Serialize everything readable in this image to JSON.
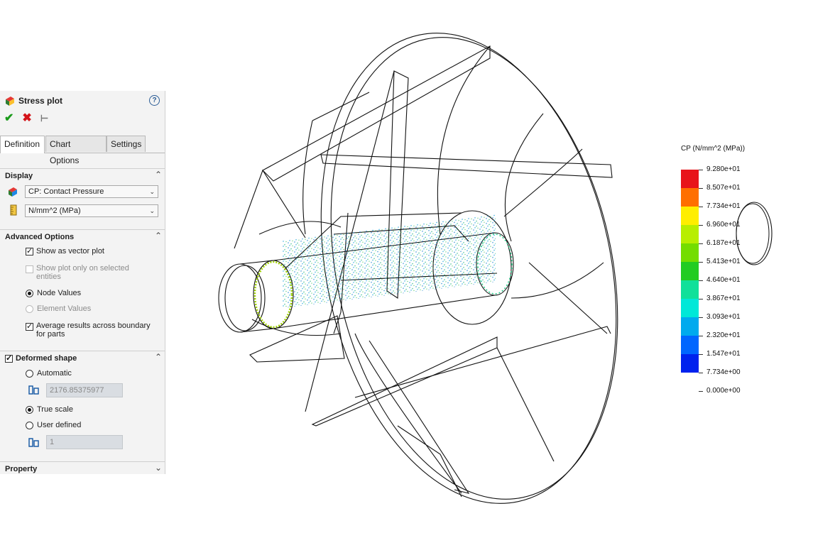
{
  "panel": {
    "title": "Stress plot",
    "help_icon": "question-icon",
    "tabs": [
      "Definition",
      "Chart Options",
      "Settings"
    ],
    "display": {
      "header": "Display",
      "component": "CP: Contact Pressure",
      "units": "N/mm^2 (MPa)"
    },
    "advanced": {
      "header": "Advanced Options",
      "show_vector": "Show as vector plot",
      "show_selected": "Show plot only on selected entities",
      "node_values": "Node Values",
      "element_values": "Element Values",
      "average": "Average results across boundary for parts"
    },
    "deformed": {
      "header": "Deformed shape",
      "automatic": "Automatic",
      "auto_value": "2176.85375977",
      "true_scale": "True scale",
      "user_defined": "User defined",
      "user_value": "1"
    },
    "property": {
      "header": "Property"
    }
  },
  "legend": {
    "title": "CP (N/mm^2 (MPa))",
    "labels": [
      "9.280e+01",
      "8.507e+01",
      "7.734e+01",
      "6.960e+01",
      "6.187e+01",
      "5.413e+01",
      "4.640e+01",
      "3.867e+01",
      "3.093e+01",
      "2.320e+01",
      "1.547e+01",
      "7.734e+00",
      "0.000e+00"
    ],
    "colors": [
      "#e8141a",
      "#ff6f00",
      "#ffee00",
      "#b8ee00",
      "#74dd00",
      "#22cc22",
      "#10e09a",
      "#00e8d8",
      "#00aaee",
      "#0066ff",
      "#0022ee"
    ]
  },
  "colors": {
    "accent": "#2c5d96",
    "ok": "#1a9a1a",
    "cancel": "#d4141a"
  }
}
